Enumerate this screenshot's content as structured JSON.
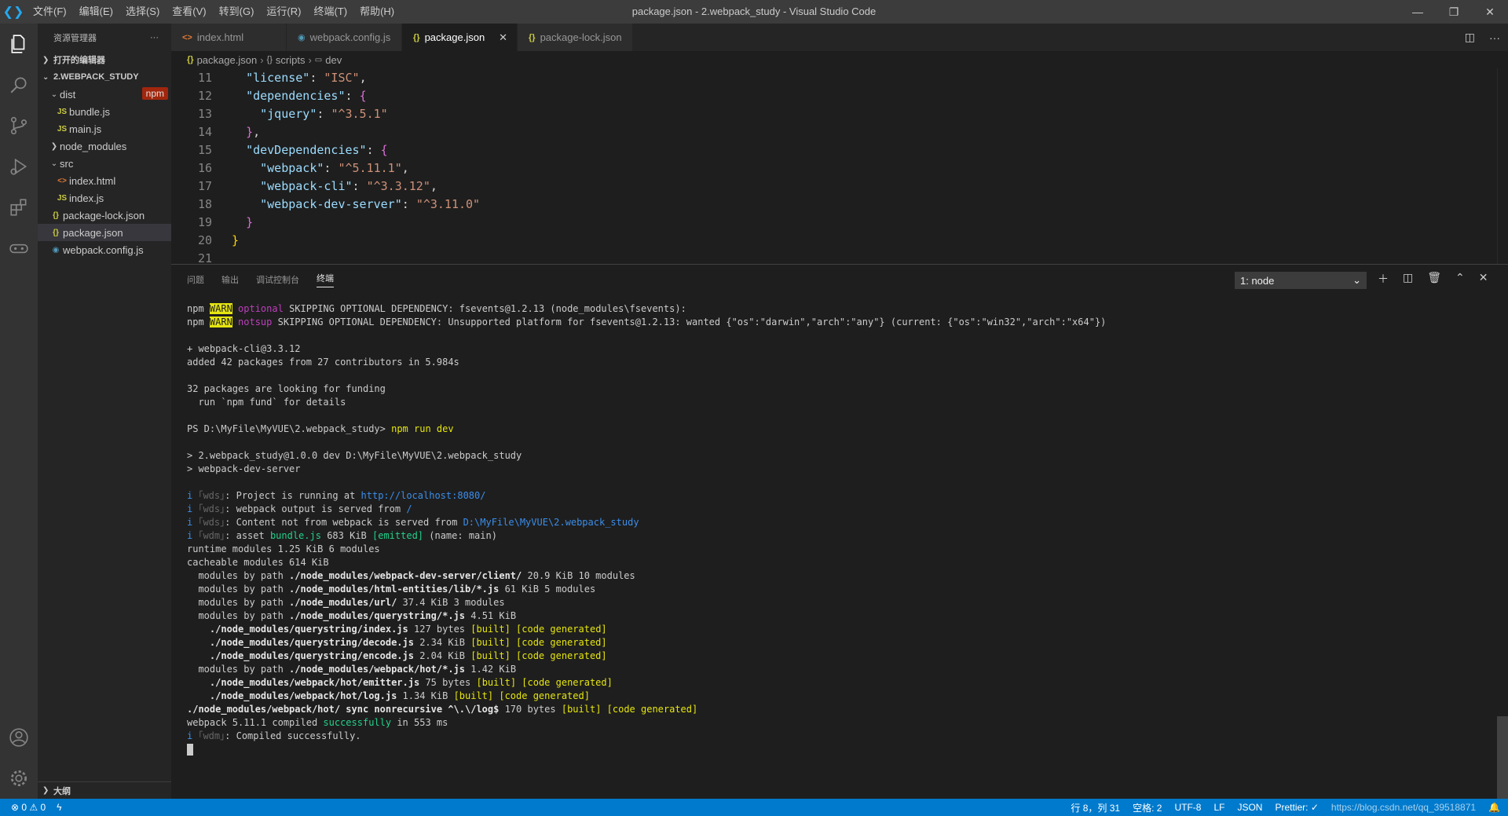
{
  "titlebar": {
    "menu": [
      "文件(F)",
      "编辑(E)",
      "选择(S)",
      "查看(V)",
      "转到(G)",
      "运行(R)",
      "终端(T)",
      "帮助(H)"
    ],
    "title": "package.json - 2.webpack_study - Visual Studio Code"
  },
  "sidebar": {
    "header": "资源管理器",
    "more": "···",
    "open_editors": "打开的编辑器",
    "project": "2.WEBPACK_STUDY",
    "items": [
      {
        "label": "dist",
        "icon": "chevron-down",
        "indent": 1
      },
      {
        "label": "bundle.js",
        "icon": "JS",
        "indent": 2
      },
      {
        "label": "main.js",
        "icon": "JS",
        "indent": 2
      },
      {
        "label": "node_modules",
        "icon": "chevron-right",
        "indent": 1
      },
      {
        "label": "src",
        "icon": "chevron-down",
        "indent": 1
      },
      {
        "label": "index.html",
        "icon": "<>",
        "indent": 2
      },
      {
        "label": "index.js",
        "icon": "JS",
        "indent": 2
      },
      {
        "label": "package-lock.json",
        "icon": "{}",
        "indent": 1
      },
      {
        "label": "package.json",
        "icon": "{}",
        "indent": 1
      },
      {
        "label": "webpack.config.js",
        "icon": "◉",
        "indent": 1
      }
    ],
    "npm_badge": "npm",
    "outline": "大纲"
  },
  "tabs": [
    {
      "label": "index.html",
      "icon": "<>"
    },
    {
      "label": "webpack.config.js",
      "icon": "◉"
    },
    {
      "label": "package.json",
      "icon": "{}",
      "active": true
    },
    {
      "label": "package-lock.json",
      "icon": "{}"
    }
  ],
  "breadcrumb": {
    "file": "package.json",
    "scripts": "scripts",
    "dev": "dev"
  },
  "editor": {
    "line_numbers": [
      "11",
      "12",
      "13",
      "14",
      "15",
      "16",
      "17",
      "18",
      "19",
      "20",
      "21"
    ]
  },
  "panel": {
    "tabs": [
      "问题",
      "输出",
      "调试控制台",
      "终端"
    ],
    "terminal_select": "1: node",
    "terminal": {
      "l1_a": "npm ",
      "l1_warn": "WARN",
      "l1_b": " optional",
      "l1_c": " SKIPPING OPTIONAL DEPENDENCY: fsevents@1.2.13 (node_modules\\fsevents):",
      "l2_a": "npm ",
      "l2_warn": "WARN",
      "l2_b": " notsup",
      "l2_c": " SKIPPING OPTIONAL DEPENDENCY: Unsupported platform for fsevents@1.2.13: wanted {\"os\":\"darwin\",\"arch\":\"any\"} (current: {\"os\":\"win32\",\"arch\":\"x64\"})",
      "l3": "+ webpack-cli@3.3.12",
      "l4": "added 42 packages from 27 contributors in 5.984s",
      "l5": "32 packages are looking for funding",
      "l6": "  run `npm fund` for details",
      "l7_a": "PS D:\\MyFile\\MyVUE\\2.webpack_study> ",
      "l7_b": "npm run dev",
      "l8": "> 2.webpack_study@1.0.0 dev D:\\MyFile\\MyVUE\\2.webpack_study",
      "l9": "> webpack-dev-server",
      "l10_a": "i ",
      "l10_b": "｢wds｣",
      "l10_c": ": Project is running at ",
      "l10_d": "http://localhost:8080/",
      "l11_a": "i ",
      "l11_b": "｢wds｣",
      "l11_c": ": webpack output is served from ",
      "l11_d": "/",
      "l12_a": "i ",
      "l12_b": "｢wds｣",
      "l12_c": ": Content not from webpack is served from ",
      "l12_d": "D:\\MyFile\\MyVUE\\2.webpack_study",
      "l13_a": "i ",
      "l13_b": "｢wdm｣",
      "l13_c": ": asset ",
      "l13_d": "bundle.js",
      "l13_e": " 683 KiB ",
      "l13_f": "[emitted]",
      "l13_g": " (name: main)",
      "l14": "runtime modules 1.25 KiB 6 modules",
      "l15": "cacheable modules 614 KiB",
      "l16_a": "  modules by path ",
      "l16_b": "./node_modules/webpack-dev-server/client/",
      "l16_c": " 20.9 KiB 10 modules",
      "l17_a": "  modules by path ",
      "l17_b": "./node_modules/html-entities/lib/*.js",
      "l17_c": " 61 KiB 5 modules",
      "l18_a": "  modules by path ",
      "l18_b": "./node_modules/url/",
      "l18_c": " 37.4 KiB 3 modules",
      "l19_a": "  modules by path ",
      "l19_b": "./node_modules/querystring/*.js",
      "l19_c": " 4.51 KiB",
      "l20_a": "    ./node_modules/querystring/index.js",
      "l20_b": " 127 bytes ",
      "l20_c": "[built] [code generated]",
      "l21_a": "    ./node_modules/querystring/decode.js",
      "l21_b": " 2.34 KiB ",
      "l21_c": "[built] [code generated]",
      "l22_a": "    ./node_modules/querystring/encode.js",
      "l22_b": " 2.04 KiB ",
      "l22_c": "[built] [code generated]",
      "l23_a": "  modules by path ",
      "l23_b": "./node_modules/webpack/hot/*.js",
      "l23_c": " 1.42 KiB",
      "l24_a": "    ./node_modules/webpack/hot/emitter.js",
      "l24_b": " 75 bytes ",
      "l24_c": "[built] [code generated]",
      "l25_a": "    ./node_modules/webpack/hot/log.js",
      "l25_b": " 1.34 KiB ",
      "l25_c": "[built] [code generated]",
      "l26_a": "./node_modules/webpack/hot/ sync nonrecursive ^\\.\\/log$",
      "l26_b": " 170 bytes ",
      "l26_c": "[built] [code generated]",
      "l27_a": "webpack 5.11.1 compiled ",
      "l27_b": "successfully",
      "l27_c": " in 553 ms",
      "l28_a": "i ",
      "l28_b": "｢wdm｣",
      "l28_c": ": Compiled successfully."
    }
  },
  "statusbar": {
    "errors": "⊗ 0 ⚠ 0",
    "position": "行 8，列 31",
    "spaces": "空格: 2",
    "encoding": "UTF-8",
    "eol": "LF",
    "language": "JSON",
    "formatter": "Prettier: ✓",
    "watermark": "https://blog.csdn.net/qq_39518871"
  }
}
